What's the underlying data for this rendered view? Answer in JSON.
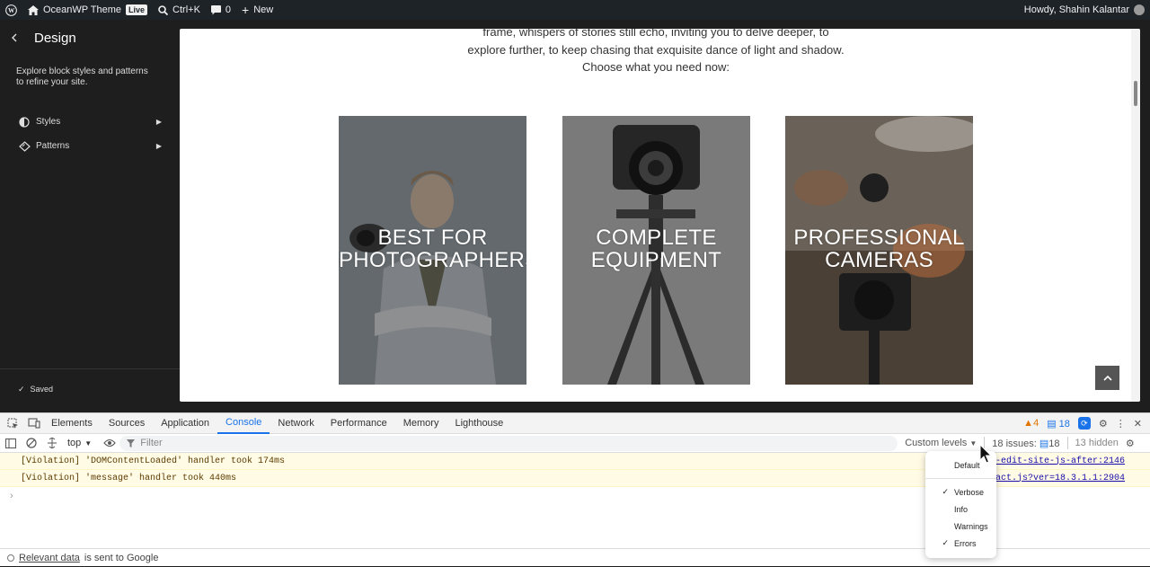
{
  "admin_bar": {
    "site_name": "OceanWP Theme",
    "live_badge": "Live",
    "shortcut": "Ctrl+K",
    "comments_count": "0",
    "new_label": "New",
    "greeting": "Howdy, Shahin Kalantar"
  },
  "sidebar": {
    "title": "Design",
    "description": "Explore block styles and patterns to refine your site.",
    "items": [
      {
        "label": "Styles"
      },
      {
        "label": "Patterns"
      }
    ],
    "saved_label": "Saved"
  },
  "preview": {
    "text": "frame, whispers of stories still echo, inviting you to delve deeper, to explore further, to keep chasing that exquisite dance of light and shadow. Choose what you need now:",
    "cards": [
      {
        "label": "BEST FOR PHOTOGRAPHERS"
      },
      {
        "label": "COMPLETE EQUIPMENT"
      },
      {
        "label": "PROFESSIONAL CAMERAS"
      }
    ]
  },
  "devtools": {
    "tabs": [
      "Elements",
      "Sources",
      "Application",
      "Console",
      "Network",
      "Performance",
      "Memory",
      "Lighthouse"
    ],
    "active_tab": "Console",
    "warn_count": "4",
    "info_count": "18",
    "context": "top",
    "filter_placeholder": "Filter",
    "levels_label": "Custom levels",
    "issues_label": "18 issues:",
    "issues_count": "18",
    "hidden_label": "13 hidden",
    "logs": [
      {
        "message": "[Violation] 'DOMContentLoaded' handler took 174ms",
        "source": "b-edit-site-js-after:2146"
      },
      {
        "message": "[Violation] 'message' handler took 440ms",
        "source": "react.js?ver=18.3.1.1:2904"
      }
    ],
    "footer_link": "Relevant data",
    "footer_text": "is sent to Google"
  },
  "levels_menu": {
    "items": [
      {
        "label": "Default",
        "checked": false
      },
      {
        "label": "Verbose",
        "checked": true
      },
      {
        "label": "Info",
        "checked": false
      },
      {
        "label": "Warnings",
        "checked": false
      },
      {
        "label": "Errors",
        "checked": true
      }
    ]
  },
  "colors": {
    "admin_bar": "#1d2327",
    "editor_bg": "#1e1e1e",
    "devtools_accent": "#1a73e8",
    "violation_bg": "#fffbe5"
  }
}
